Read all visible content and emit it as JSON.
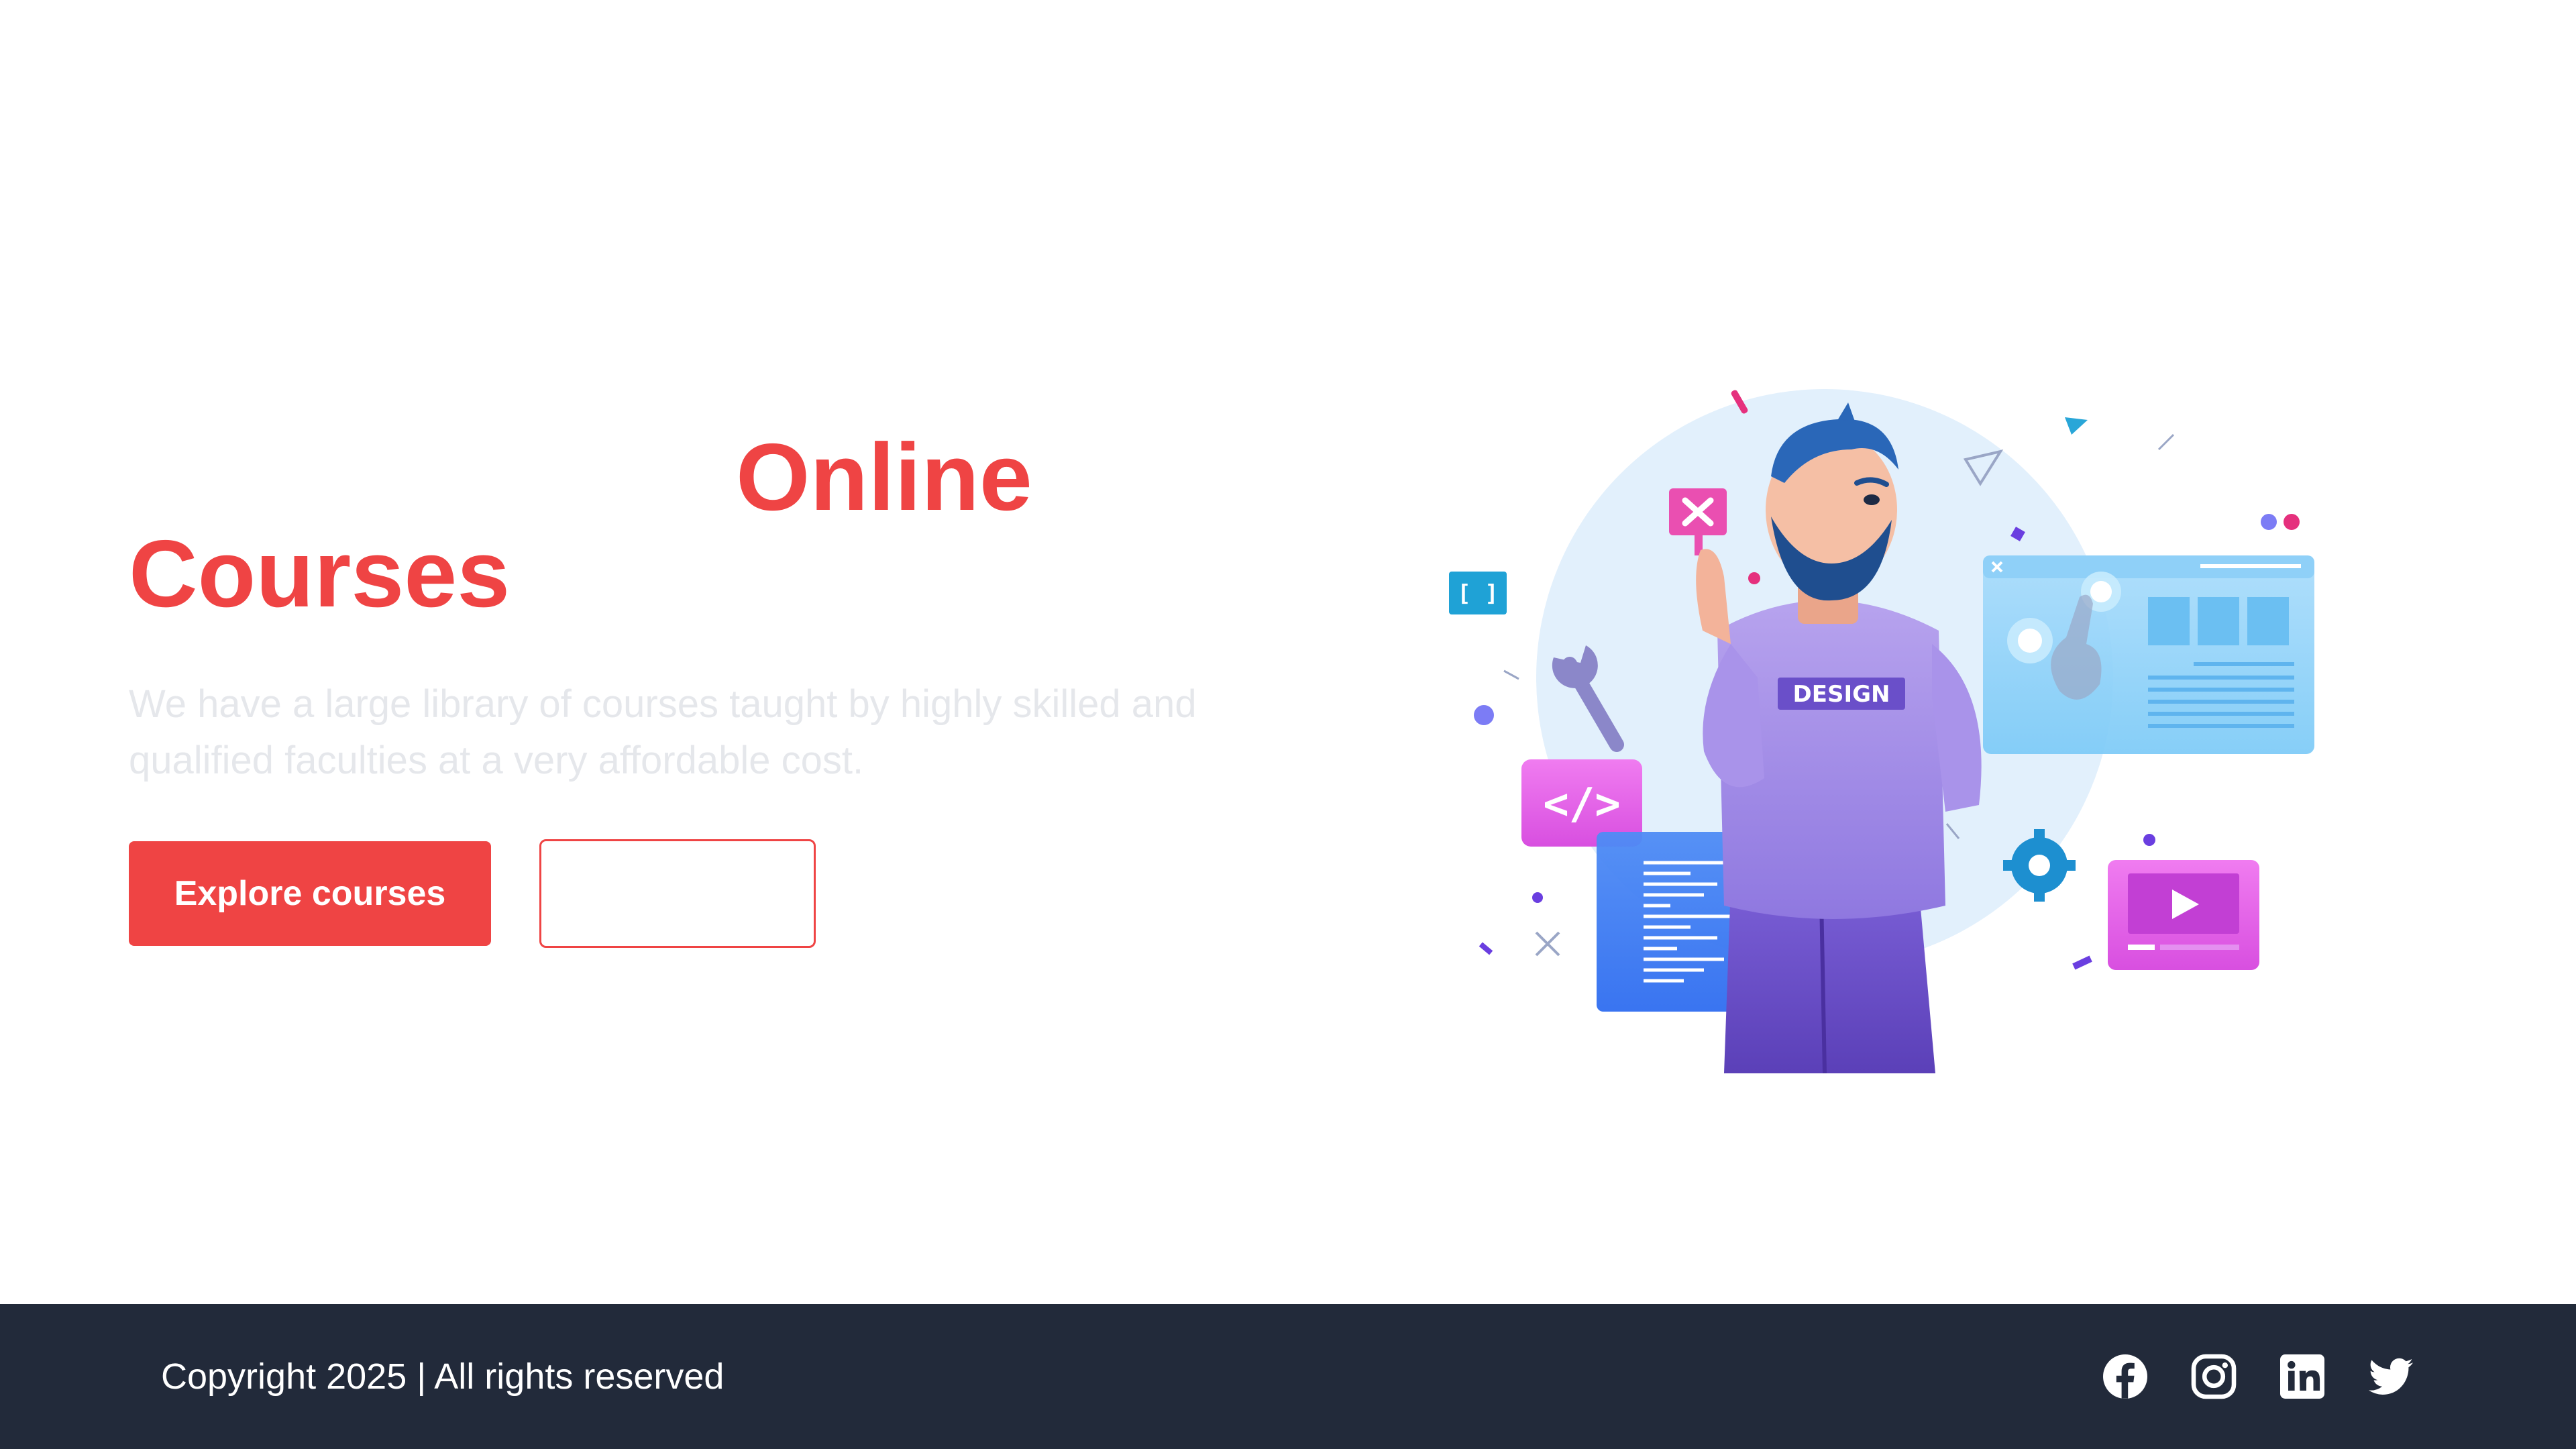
{
  "hero": {
    "headline_word_1": "Online",
    "headline_word_2": "Courses",
    "description": "We have a large library of courses taught by highly skilled and qualified faculties at a very affordable cost.",
    "primary_button_label": "Explore courses",
    "secondary_button_label": "",
    "illustration": {
      "badge_text": "DESIGN",
      "bracket_icon_text": "[ ]",
      "code_icon_text": "</>"
    }
  },
  "footer": {
    "copyright": "Copyright 2025 | All rights reserved",
    "social_icons": [
      "facebook-icon",
      "instagram-icon",
      "linkedin-icon",
      "twitter-icon"
    ]
  },
  "colors": {
    "accent": "#ef4444",
    "footer_bg": "#222a3a",
    "description_text": "#e5e7eb",
    "footer_text": "#ffffff"
  }
}
